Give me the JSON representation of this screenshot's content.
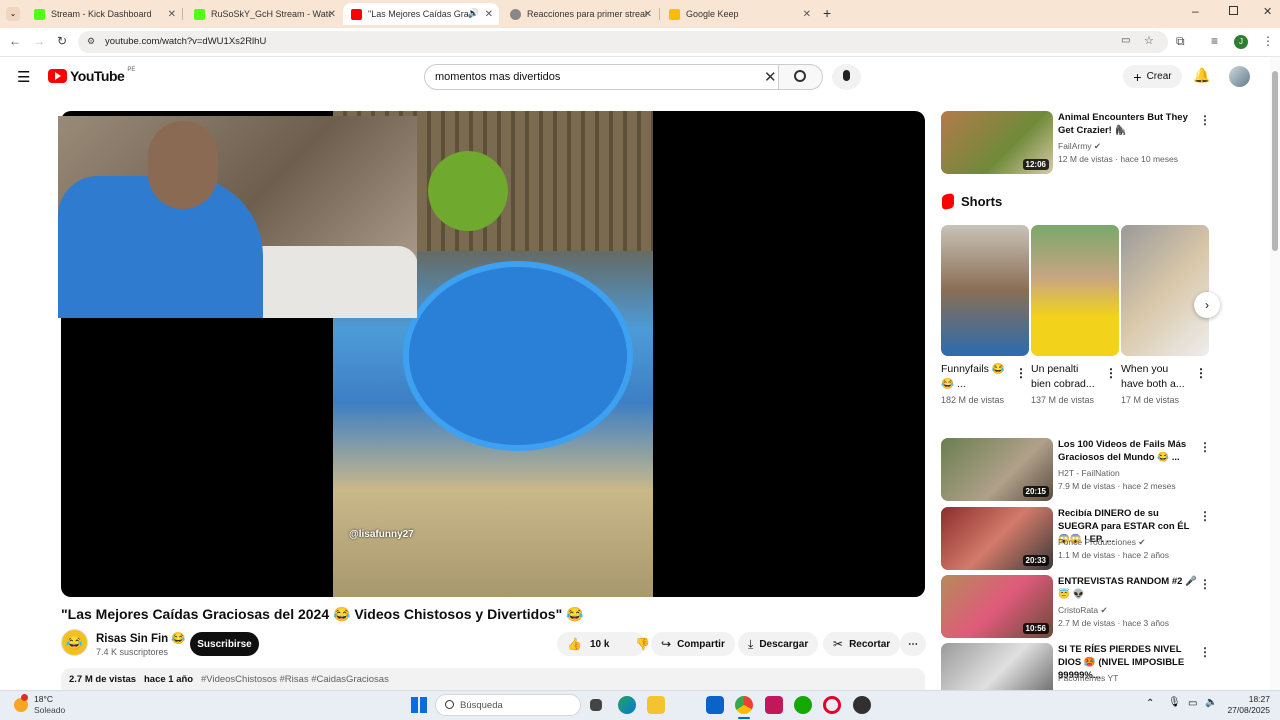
{
  "browser": {
    "tabs": [
      {
        "title": "Stream - Kick Dashboard",
        "favicon_color": "#53fc18",
        "active": false
      },
      {
        "title": "RuSoSkY_GcH Stream - Watch Li",
        "favicon_color": "#53fc18",
        "active": false
      },
      {
        "title": "\"Las Mejores Caídas Graciosas",
        "favicon_color": "#ff0000",
        "active": true
      },
      {
        "title": "Reacciones para primer stream",
        "favicon_color": "#666666",
        "active": false
      },
      {
        "title": "Google Keep",
        "favicon_color": "#fbbc04",
        "active": false
      }
    ],
    "url": "youtube.com/watch?v=dWU1Xs2RlhU",
    "profile_initial": "J"
  },
  "youtube": {
    "logo_text": "YouTube",
    "region": "PE",
    "search_value": "momentos mas divertidos",
    "create_label": "Crear"
  },
  "video": {
    "watermark": "@lisafunny27",
    "title": "\"Las Mejores Caídas Graciosas del 2024 😂  Videos Chistosos y Divertidos\" 😂",
    "channel_name": "Risas Sin Fin 😂",
    "subscribers": "7.4 K suscriptores",
    "subscribe_label": "Suscribirse",
    "likes": "10 k",
    "share_label": "Compartir",
    "download_label": "Descargar",
    "clip_label": "Recortar",
    "views": "2.7 M de vistas",
    "age": "hace 1 año",
    "hashtags": "#VideosChistosos #Risas #CaidasGraciosas"
  },
  "sidebar": {
    "top_video": {
      "title": "Animal Encounters But They Get Crazier! 🦍",
      "channel": "FailArmy ✔",
      "meta": "12 M de vistas · hace 10 meses",
      "duration": "12:06"
    },
    "shorts_heading": "Shorts",
    "shorts": [
      {
        "title": "Funnyfails 😂😂 ...",
        "views": "182 M de vistas"
      },
      {
        "title": "Un penalti bien cobrad...",
        "views": "137 M de vistas"
      },
      {
        "title": "When you have both a...",
        "views": "17 M de vistas"
      }
    ],
    "videos": [
      {
        "title": "Los 100 Videos de Fails Más Graciosos del Mundo 😂 ...",
        "channel": "H2T - FailNation",
        "meta": "7.9 M de vistas · hace 2 meses",
        "duration": "20:15"
      },
      {
        "title": "Recibía DINERO de su SUEGRA para ESTAR con ÉL 😱😱 | EP. ...",
        "channel": "Ponce Producciones ✔",
        "meta": "1.1 M de vistas · hace 2 años",
        "duration": "20:33"
      },
      {
        "title": "ENTREVISTAS RANDOM #2 🎤 😇 👽",
        "channel": "CristoRata ✔",
        "meta": "2.7 M de vistas · hace 3 años",
        "duration": "10:56"
      },
      {
        "title": "SI TE RÍES PIERDES NIVEL DIOS 🥵 (NIVEL IMPOSIBLE 99999%...",
        "channel": "Pacomemes YT",
        "meta": "",
        "duration": ""
      }
    ]
  },
  "taskbar": {
    "temperature": "18°C",
    "weather": "Soleado",
    "search_placeholder": "Búsqueda",
    "time": "18:27",
    "date": "27/08/2025"
  }
}
